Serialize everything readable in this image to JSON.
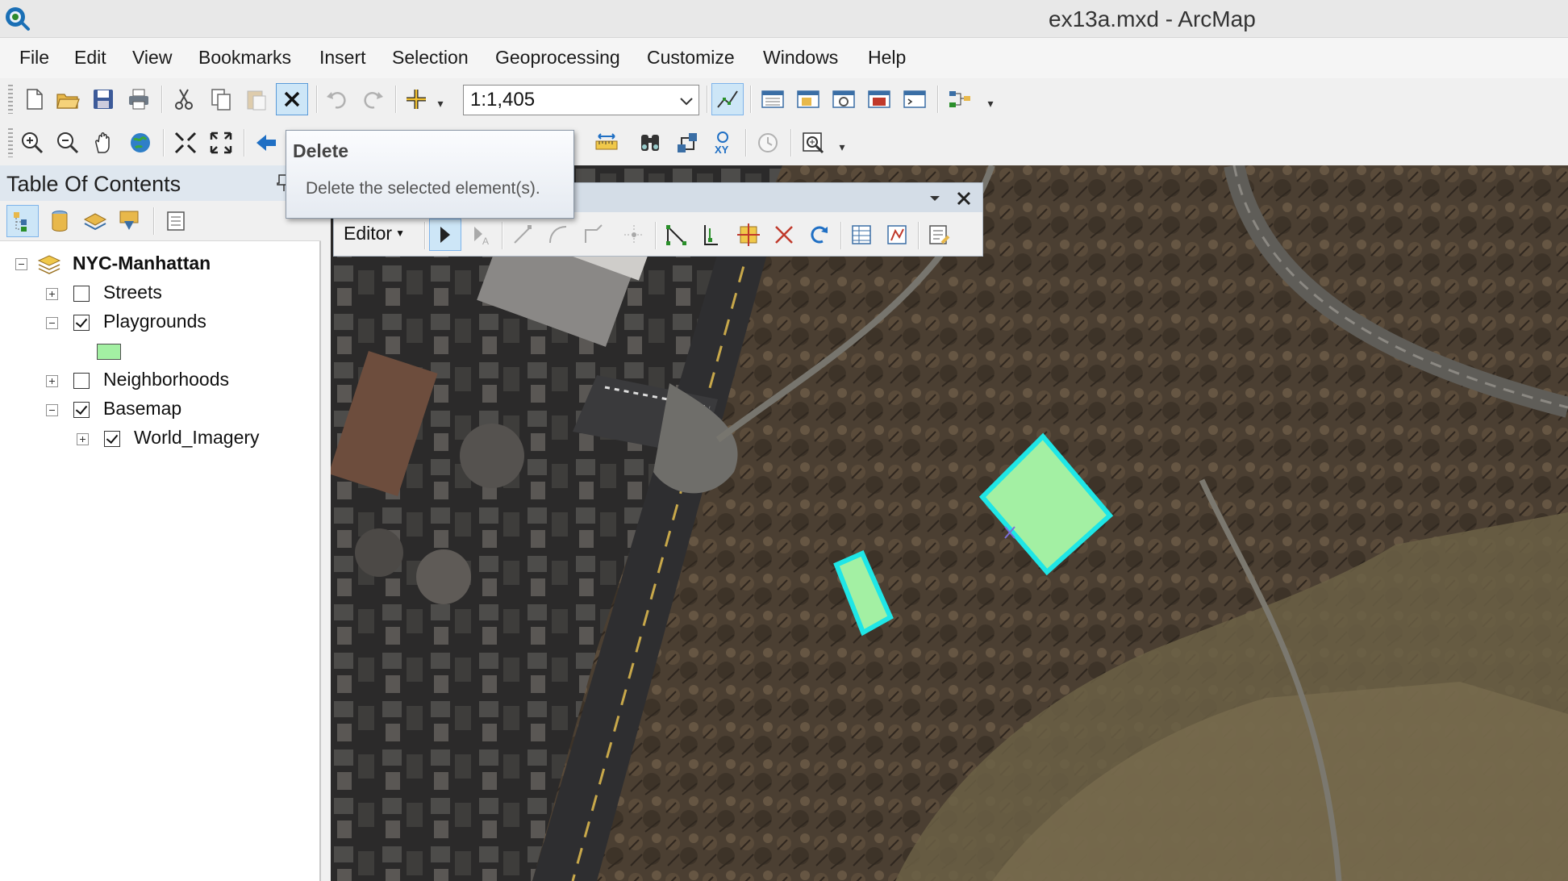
{
  "window": {
    "title": "ex13a.mxd - ArcMap",
    "app_icon": "arcmap-globe-icon"
  },
  "menu": {
    "items": [
      "File",
      "Edit",
      "View",
      "Bookmarks",
      "Insert",
      "Selection",
      "Geoprocessing",
      "Customize",
      "Windows",
      "Help"
    ]
  },
  "standard_toolbar": {
    "scale": "1:1,405",
    "icons": [
      "new-document-icon",
      "open-folder-icon",
      "save-icon",
      "print-icon",
      "cut-icon",
      "copy-icon",
      "paste-icon",
      "delete-icon",
      "undo-icon",
      "redo-icon",
      "add-data-icon",
      "editor-toolbar-icon",
      "table-of-contents-icon",
      "catalog-icon",
      "search-window-icon",
      "arctoolbox-icon",
      "python-icon",
      "model-builder-icon"
    ]
  },
  "tools_toolbar": {
    "icons": [
      "zoom-in-icon",
      "zoom-out-icon",
      "pan-icon",
      "full-extent-icon",
      "fixed-zoom-in-icon",
      "fixed-zoom-out-icon",
      "back-extent-icon",
      "measure-icon",
      "find-icon",
      "find-route-icon",
      "go-to-xy-icon",
      "time-slider-icon",
      "magnifier-window-icon"
    ]
  },
  "tooltip": {
    "title": "Delete",
    "description": "Delete the selected element(s)."
  },
  "toc": {
    "title": "Table Of Contents",
    "tools": [
      "list-by-drawing-order-icon",
      "list-by-source-icon",
      "list-by-visibility-icon",
      "list-by-selection-icon",
      "options-icon"
    ],
    "data_frame": "NYC-Manhattan",
    "layers": [
      {
        "name": "Streets",
        "checked": false,
        "expanded": false
      },
      {
        "name": "Playgrounds",
        "checked": true,
        "expanded": true,
        "symbol_color": "#a3f0a3"
      },
      {
        "name": "Neighborhoods",
        "checked": false,
        "expanded": false
      },
      {
        "name": "Basemap",
        "checked": true,
        "expanded": true
      },
      {
        "name": "World_Imagery",
        "checked": true,
        "expanded": false
      }
    ]
  },
  "editor_toolbar": {
    "menu_label": "Editor",
    "icons": [
      "edit-tool-icon",
      "edit-annotation-icon",
      "straight-segment-icon",
      "end-point-arc-icon",
      "trace-icon",
      "point-icon",
      "edit-vertices-icon",
      "reshape-feature-icon",
      "cut-polygons-icon",
      "split-icon",
      "rotate-icon",
      "attributes-icon",
      "sketch-properties-icon",
      "create-features-icon"
    ]
  },
  "map": {
    "selection_color": "#1fe6e6",
    "playground_fill": "#a3f0a3"
  }
}
